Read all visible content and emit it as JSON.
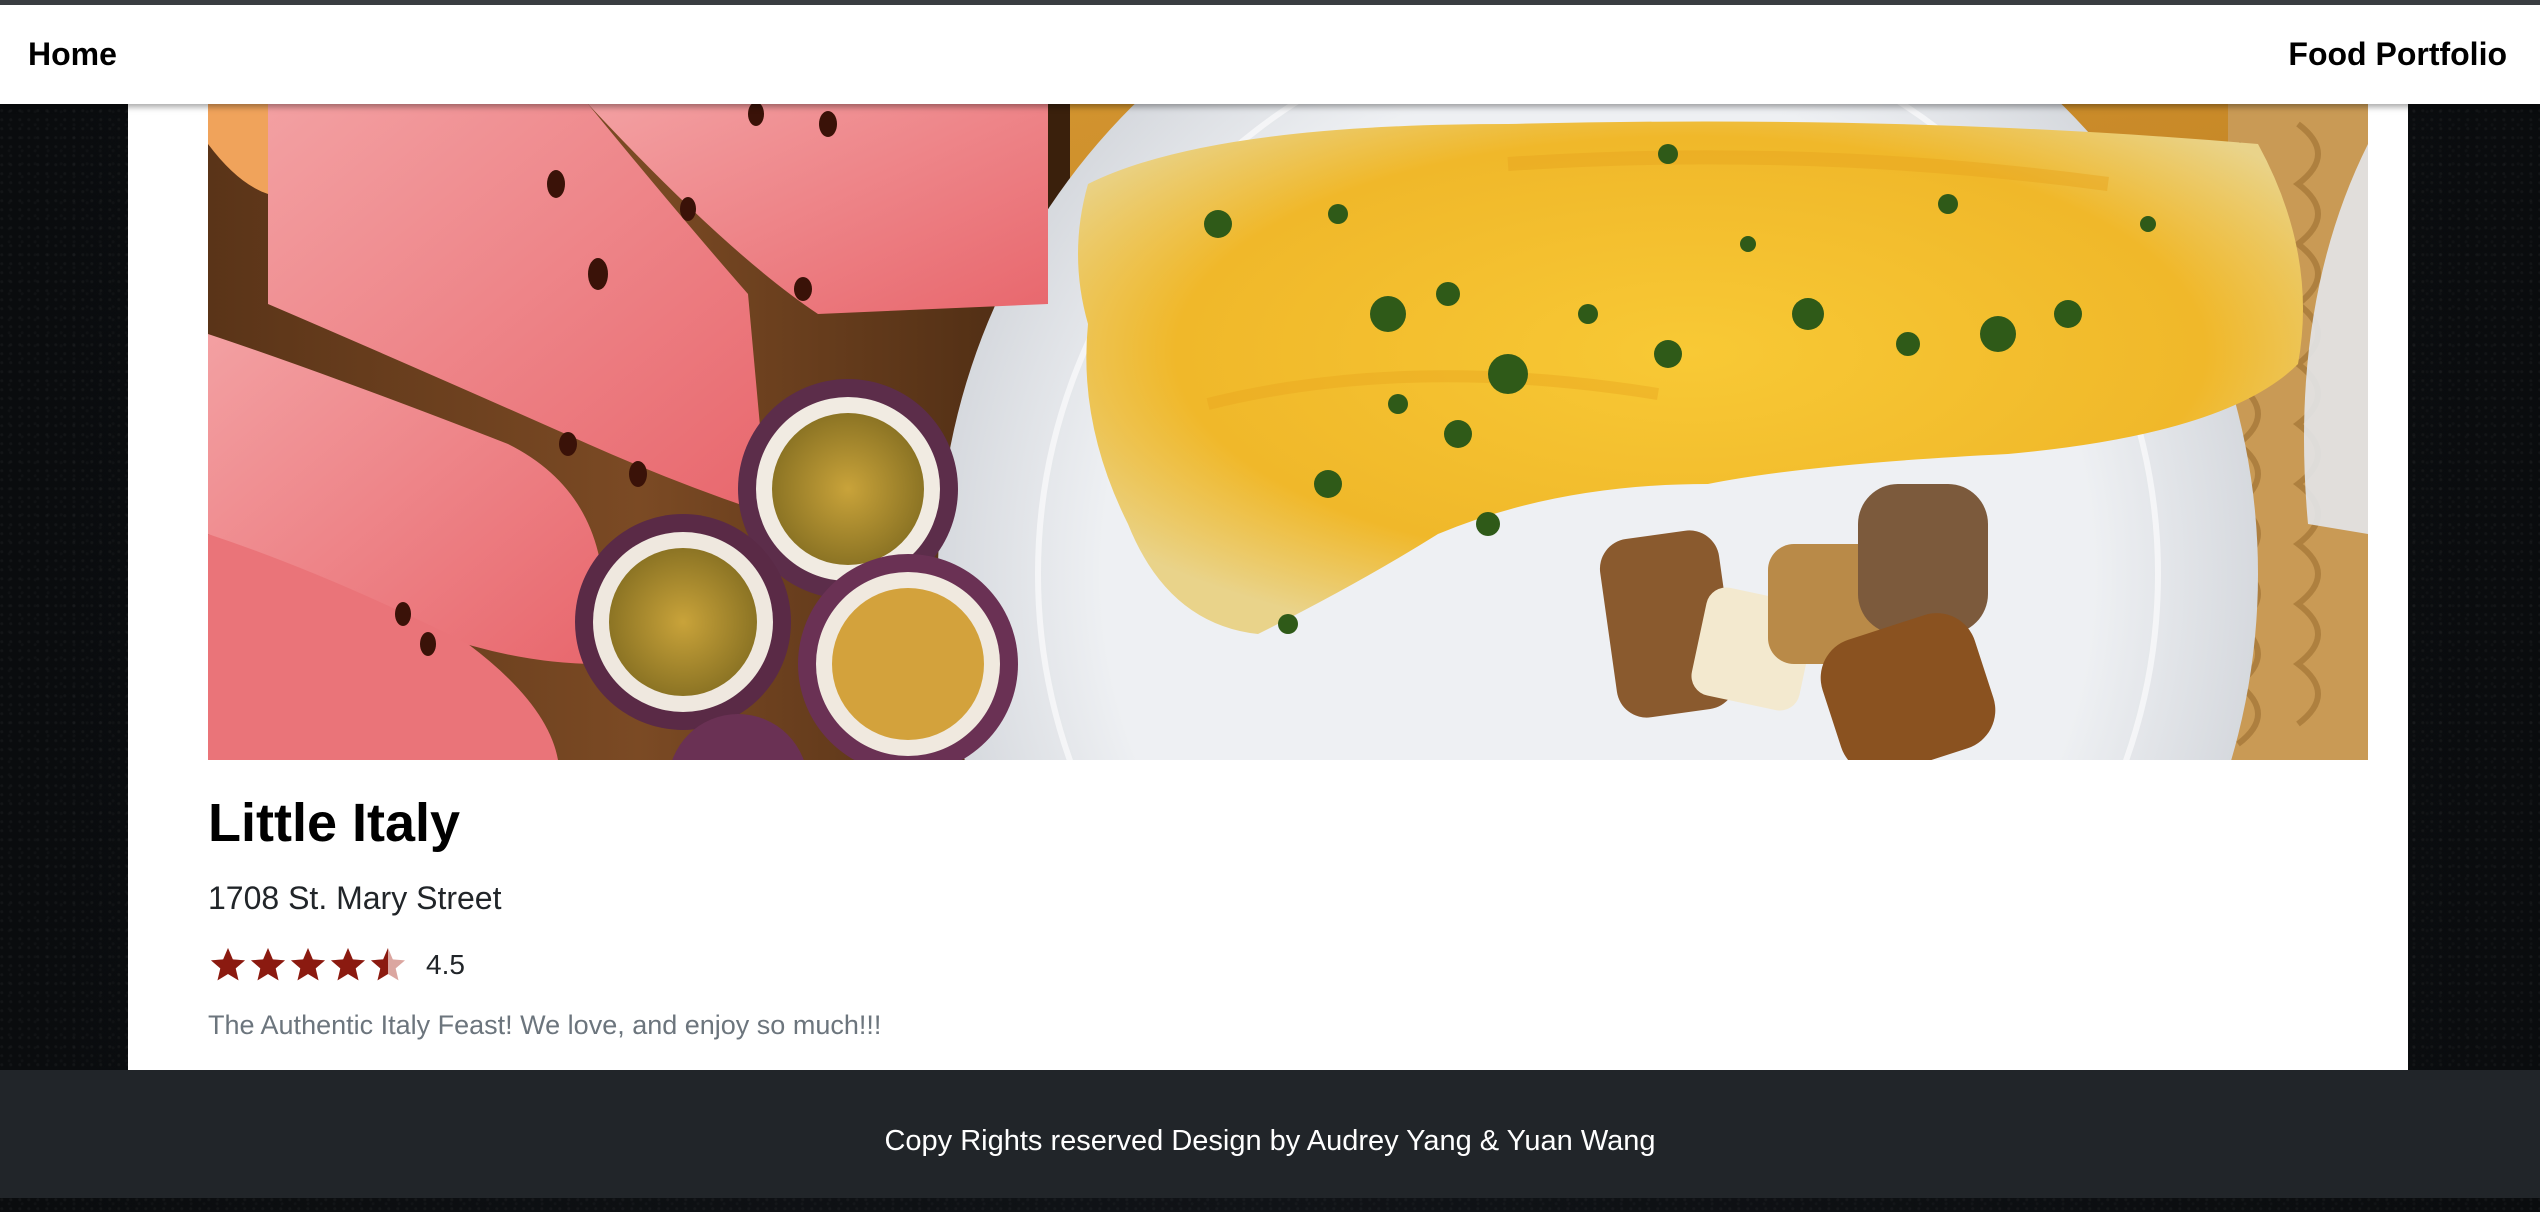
{
  "navbar": {
    "home_label": "Home",
    "brand_label": "Food Portfolio"
  },
  "restaurant": {
    "image_icon": "food-photo-watermelon-passionfruit-omelette",
    "name": "Little Italy",
    "address": "1708 St. Mary Street",
    "rating": 4.5,
    "rating_text": "4.5",
    "rating_max": 5,
    "description": "The Authentic Italy Feast! We love, and enjoy so much!!!"
  },
  "footer": {
    "text": "Copy Rights reserved Design by Audrey Yang & Yuan Wang"
  },
  "colors": {
    "star_filled": "#8b1a10",
    "star_empty": "#dba6a0",
    "footer_bg": "#212529",
    "page_bg": "#0d0f12"
  }
}
